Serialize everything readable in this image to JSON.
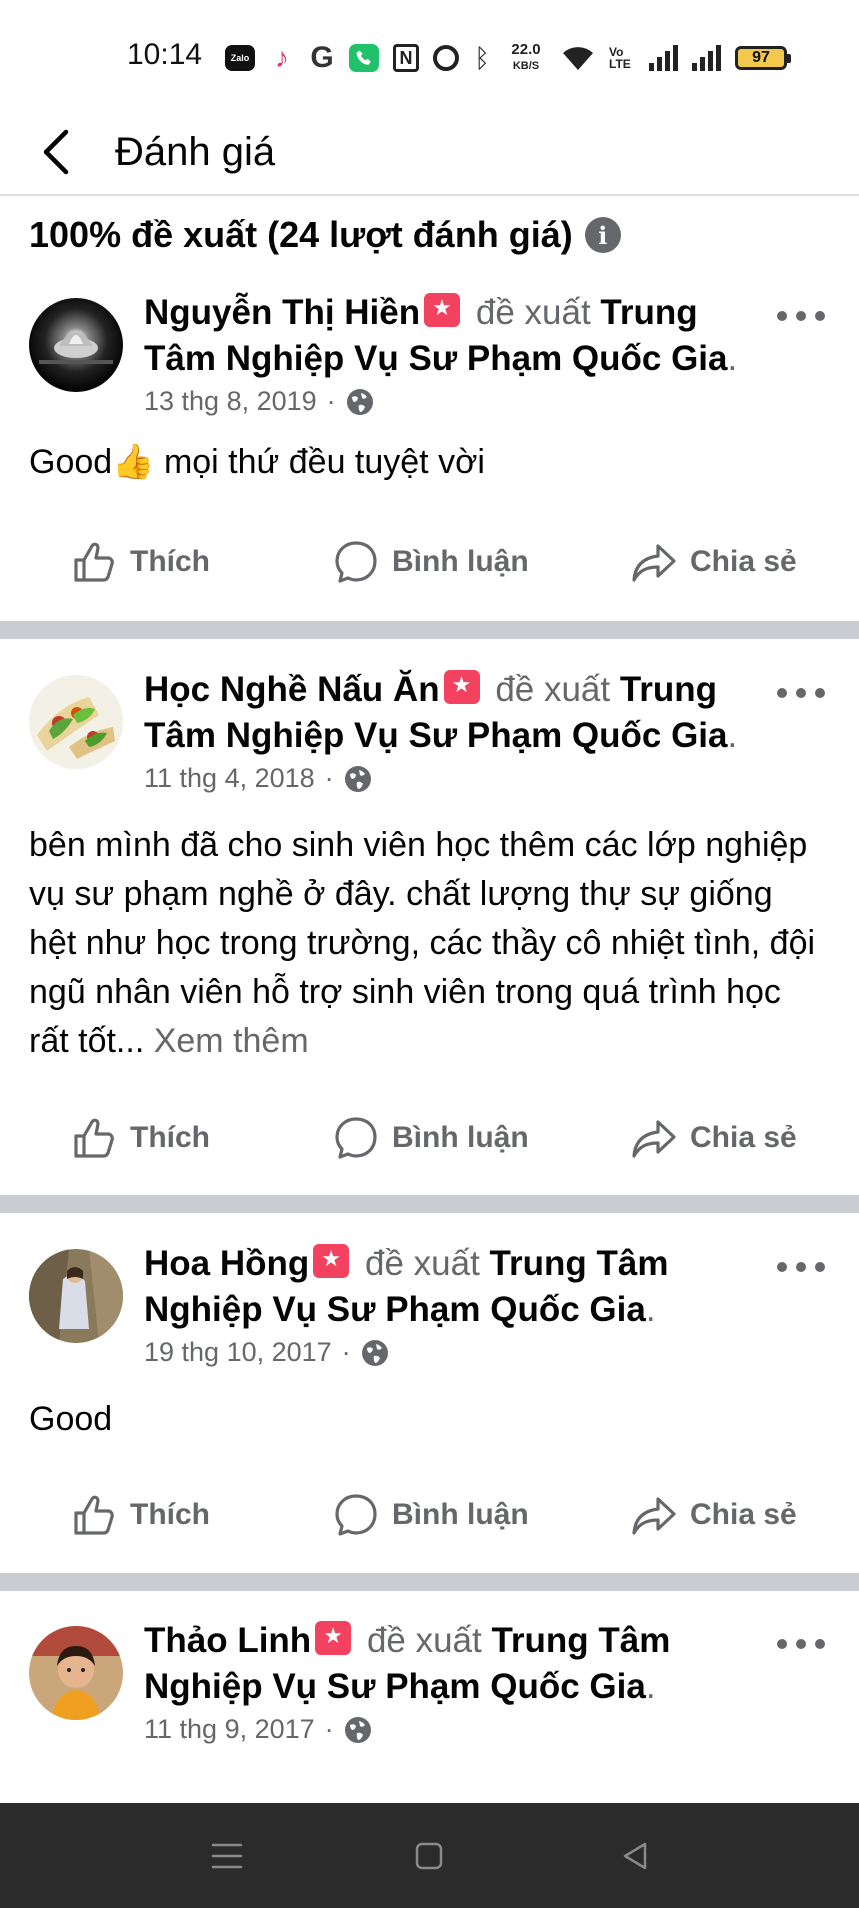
{
  "status_bar": {
    "time": "10:14",
    "icons": [
      "zalo-icon",
      "tiktok-icon",
      "g-icon",
      "phone-icon",
      "nfc-icon",
      "alarm-icon",
      "bluetooth-icon",
      "wifi-icon",
      "volte-icon",
      "signal-icon",
      "battery-icon"
    ],
    "zalo_label": "Zalo",
    "net_speed_value": "22.0",
    "net_speed_unit": "KB/S",
    "volte_label": "Vo LTE",
    "battery": "97"
  },
  "header": {
    "title": "Đánh giá"
  },
  "summary": {
    "text": "100% đề xuất (24 lượt đánh giá)"
  },
  "common": {
    "recommends": "đề xuất",
    "like": "Thích",
    "comment": "Bình luận",
    "share": "Chia sẻ"
  },
  "reviews": [
    {
      "author": "Nguyễn Thị Hiền",
      "page": "Trung Tâm Nghiệp Vụ Sư Phạm Quốc Gia",
      "date": "13 thg 8, 2019",
      "text": "Good👍 mọi thứ đều tuyệt vời",
      "see_more": ""
    },
    {
      "author": "Học Nghề Nấu Ăn",
      "page": "Trung Tâm Nghiệp Vụ Sư Phạm Quốc Gia",
      "date": "11 thg 4, 2018",
      "text": "bên mình đã cho sinh viên học thêm các lớp nghiệp vụ sư phạm nghề ở đây. chất lượng thự sự giống hệt như học trong trường, các thầy cô nhiệt tình, đội ngũ nhân viên hỗ trợ sinh viên trong quá trình học rất tốt...",
      "see_more": "Xem thêm"
    },
    {
      "author": "Hoa Hồng",
      "page": "Trung Tâm Nghiệp Vụ Sư Phạm Quốc Gia",
      "date": "19 thg 10, 2017",
      "text": "Good",
      "see_more": ""
    },
    {
      "author": "Thảo Linh",
      "page": "Trung Tâm Nghiệp Vụ Sư Phạm Quốc Gia",
      "date": "11 thg 9, 2017",
      "text": "",
      "see_more": ""
    }
  ],
  "nav": {
    "icons": [
      "menu-icon",
      "home-icon",
      "back-triangle-icon"
    ]
  }
}
